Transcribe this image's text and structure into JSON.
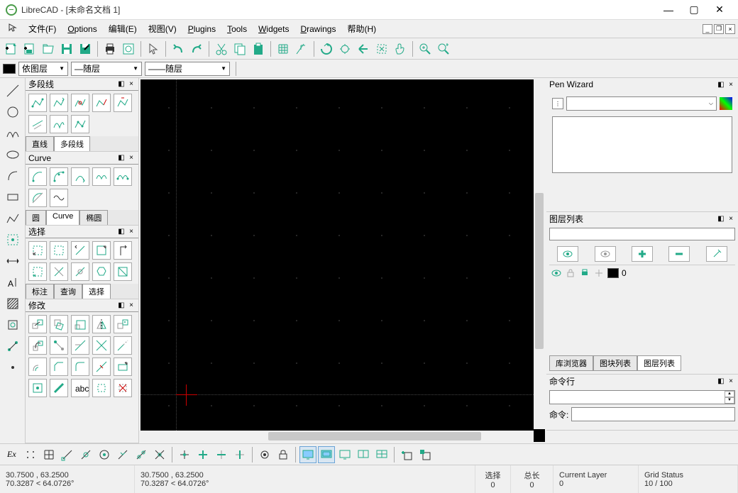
{
  "app_title": "LibreCAD - [未命名文档 1]",
  "menubar": {
    "file": "文件(F)",
    "options": "Options",
    "edit": "编辑(E)",
    "view": "视图(V)",
    "plugins": "Plugins",
    "tools": "Tools",
    "widgets": "Widgets",
    "drawings": "Drawings",
    "help": "帮助(H)"
  },
  "layerbar": {
    "bylayer": "依图层",
    "bylayer2": "随层",
    "bylayer3": "随层"
  },
  "panels": {
    "polyline_title": "多段线",
    "polyline_tabs": {
      "line": "直线",
      "polyline": "多段线"
    },
    "curve_title": "Curve",
    "curve_tabs": {
      "circle": "圆",
      "curve": "Curve",
      "ellipse": "椭圆"
    },
    "select_title": "选择",
    "select_tabs": {
      "dim": "标注",
      "query": "查询",
      "select": "选择"
    },
    "modify_title": "修改"
  },
  "right": {
    "penwizard_title": "Pen Wizard",
    "layerlist_title": "图层列表",
    "layerlist_tabs": {
      "lib": "库浏览器",
      "block": "图块列表",
      "layer": "图层列表"
    },
    "layer0_name": "0",
    "cmd_title": "命令行",
    "cmd_label": "命令:"
  },
  "bottombar_ex": "Ex",
  "status": {
    "coord1_abs": "30.7500 , 63.2500",
    "coord1_rel": "70.3287 < 64.0726°",
    "coord2_abs": "30.7500 , 63.2500",
    "coord2_rel": "70.3287 < 64.0726°",
    "sel_label": "选择",
    "sel_val": "0",
    "len_label": "总长",
    "len_val": "0",
    "layer_label": "Current Layer",
    "layer_val": "0",
    "grid_label": "Grid Status",
    "grid_val": "10 / 100"
  }
}
